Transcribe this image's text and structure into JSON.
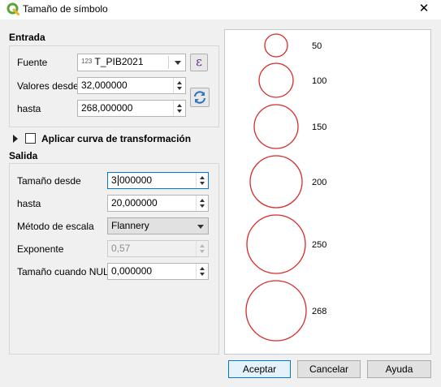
{
  "window": {
    "title": "Tamaño de símbolo",
    "close_glyph": "✕"
  },
  "input_section": {
    "heading": "Entrada",
    "source_label": "Fuente",
    "source_type_badge": "123",
    "source_value": "T_PIB2021",
    "values_from_label": "Valores desde",
    "values_from": "32,000000",
    "to_label": "hasta",
    "values_to": "268,000000",
    "expression_glyph": "ε"
  },
  "transform_curve": {
    "label": "Aplicar curva de transformación",
    "checked": false
  },
  "output_section": {
    "heading": "Salida",
    "size_from_label": "Tamaño desde",
    "size_from": "3,000000",
    "to_label": "hasta",
    "size_to": "20,000000",
    "method_label": "Método de escala",
    "method_value": "Flannery",
    "exponent_label": "Exponente",
    "exponent_value": "0,57",
    "null_size_label": "Tamaño cuando NULO",
    "null_size_value": "0,000000"
  },
  "preview": {
    "legend": [
      {
        "value": "50"
      },
      {
        "value": "100"
      },
      {
        "value": "150"
      },
      {
        "value": "200"
      },
      {
        "value": "250"
      },
      {
        "value": "268"
      }
    ],
    "circle_color": "#d92a2a"
  },
  "buttons": {
    "ok": "Aceptar",
    "cancel": "Cancelar",
    "help": "Ayuda"
  },
  "colors": {
    "qgis_green": "#5ea33a",
    "refresh_blue": "#2f76c4"
  }
}
